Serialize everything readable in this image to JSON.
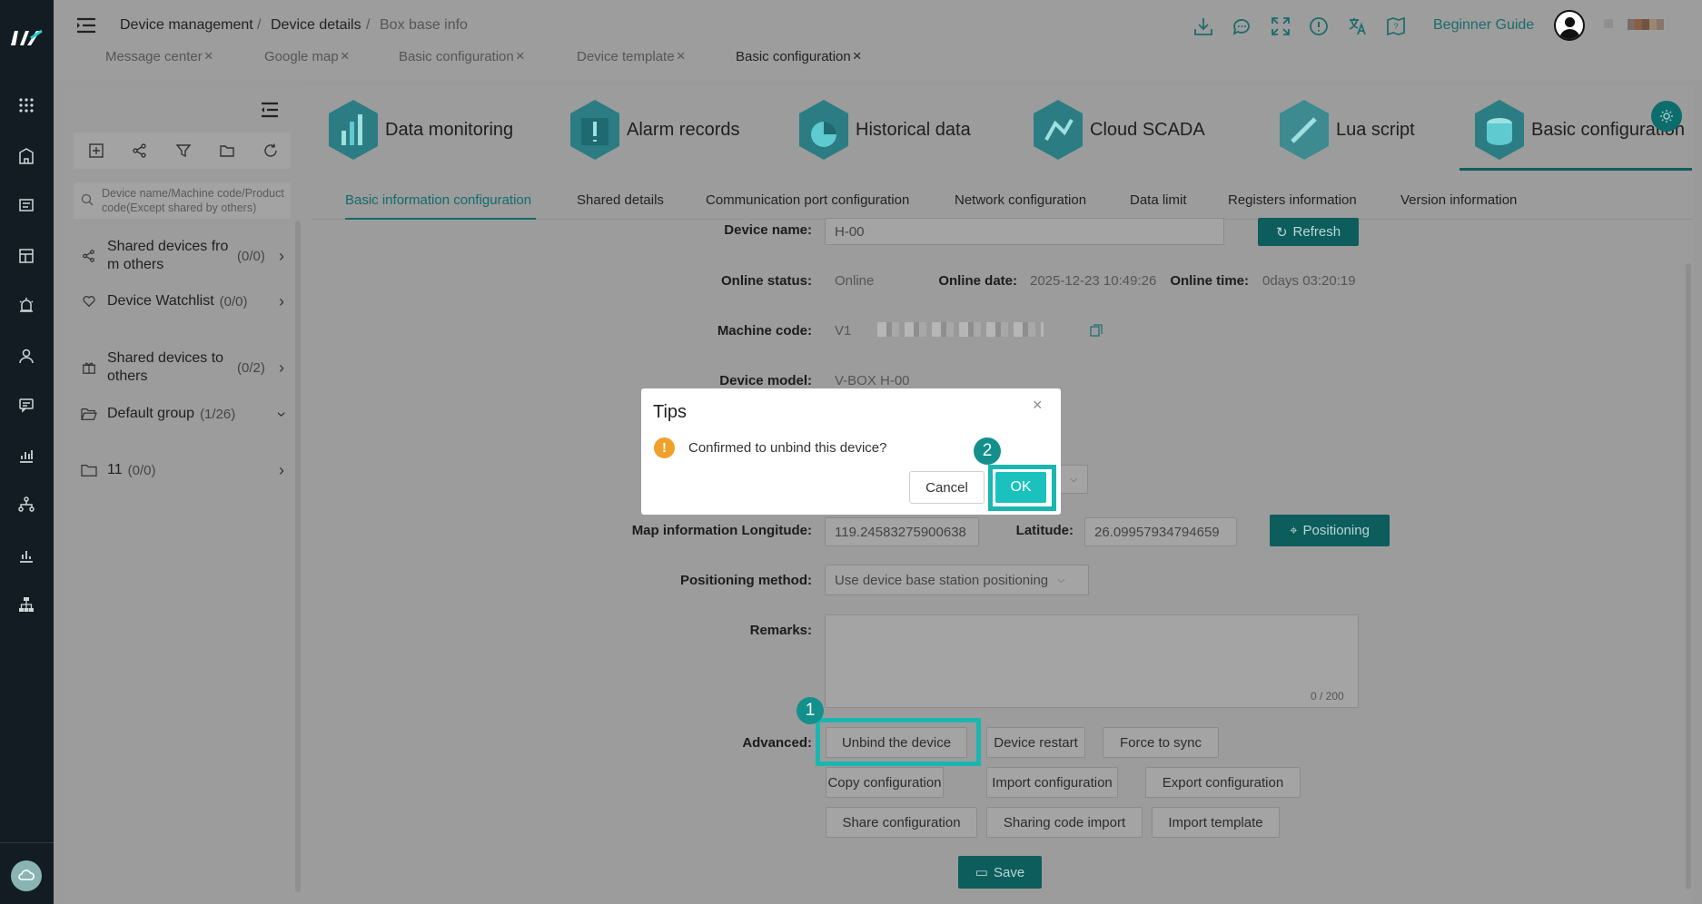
{
  "breadcrumb": [
    "Device management",
    "Device details",
    "Box base info"
  ],
  "top_tabs": [
    {
      "label": "Message center"
    },
    {
      "label": "Google map"
    },
    {
      "label": "Basic configuration"
    },
    {
      "label": "Device template"
    },
    {
      "label": "Basic configuration"
    }
  ],
  "header": {
    "guide": "Beginner Guide"
  },
  "sidebar_search_placeholder": "Device name/Machine code/Product code(Except shared by others)",
  "tree": [
    {
      "label": "Shared devices fro m others",
      "count": "(0/0)"
    },
    {
      "label": "Device Watchlist",
      "count": "(0/0)"
    },
    {
      "label": "Shared devices to others",
      "count": "(0/2)"
    },
    {
      "label": "Default group",
      "count": "(1/26)"
    },
    {
      "label": "11",
      "count": "(0/0)"
    }
  ],
  "modules": [
    "Data monitoring",
    "Alarm records",
    "Historical data",
    "Cloud SCADA",
    "Lua script",
    "Basic configuration"
  ],
  "subtabs": [
    "Basic information configuration",
    "Shared details",
    "Communication port configuration",
    "Network configuration",
    "Data limit",
    "Registers information",
    "Version information"
  ],
  "form": {
    "device_name_label": "Device name:",
    "device_name": "H-00",
    "refresh": "Refresh",
    "online_status_label": "Online status:",
    "online_status": "Online",
    "online_date_label": "Online date:",
    "online_date": "2025-12-23 10:49:26",
    "online_time_label": "Online time:",
    "online_time": "0days 03:20:19",
    "machine_code_label": "Machine code:",
    "machine_code_prefix": "V1",
    "device_model_label": "Device model:",
    "device_model": "V-BOX H-00",
    "longitude_label": "Map information Longitude:",
    "longitude": "119.24583275900638",
    "latitude_label": "Latitude:",
    "latitude": "26.09957934794659",
    "positioning": "Positioning",
    "positioning_method_label": "Positioning method:",
    "positioning_method": "Use device base station positioning",
    "remarks_label": "Remarks:",
    "remarks_counter": "0 / 200",
    "advanced_label": "Advanced:",
    "buttons": [
      "Unbind the device",
      "Device restart",
      "Force to sync",
      "Copy configuration",
      "Import configuration",
      "Export configuration",
      "Share configuration",
      "Sharing code import",
      "Import template"
    ],
    "save": "Save"
  },
  "annotations": [
    "1",
    "2"
  ],
  "dialog": {
    "title": "Tips",
    "message": "Confirmed to unbind this device?",
    "cancel": "Cancel",
    "ok": "OK",
    "close": "×",
    "warn": "!"
  },
  "colors": {
    "accent": "#1ac1bd",
    "teal_dark": "#0d5d5d",
    "highlight": "#1bb6b0",
    "rail": "#121c22"
  }
}
